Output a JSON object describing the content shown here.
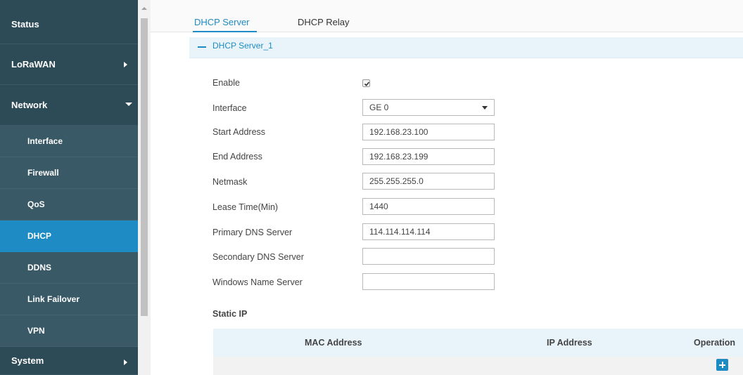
{
  "sidebar": {
    "items": [
      {
        "label": "Status"
      },
      {
        "label": "LoRaWAN"
      },
      {
        "label": "Network"
      },
      {
        "label": "Interface"
      },
      {
        "label": "Firewall"
      },
      {
        "label": "QoS"
      },
      {
        "label": "DHCP"
      },
      {
        "label": "DDNS"
      },
      {
        "label": "Link Failover"
      },
      {
        "label": "VPN"
      },
      {
        "label": "System"
      }
    ]
  },
  "tabs": [
    {
      "label": "DHCP Server"
    },
    {
      "label": "DHCP Relay"
    }
  ],
  "section": {
    "title": "DHCP Server_1"
  },
  "form": {
    "enable_label": "Enable",
    "enable_checked": true,
    "interface_label": "Interface",
    "interface_value": "GE 0",
    "start_label": "Start Address",
    "start_value": "192.168.23.100",
    "end_label": "End Address",
    "end_value": "192.168.23.199",
    "netmask_label": "Netmask",
    "netmask_value": "255.255.255.0",
    "lease_label": "Lease Time(Min)",
    "lease_value": "1440",
    "primary_dns_label": "Primary DNS Server",
    "primary_dns_value": "114.114.114.114",
    "secondary_dns_label": "Secondary DNS Server",
    "secondary_dns_value": "",
    "wins_label": "Windows Name Server",
    "wins_value": ""
  },
  "static_ip": {
    "title": "Static IP",
    "columns": [
      "MAC Address",
      "IP Address",
      "Operation"
    ]
  },
  "icons": {
    "add": "plus-icon",
    "collapse": "minus-icon",
    "expand": "caret-right-icon",
    "expanded": "caret-down-icon"
  },
  "colors": {
    "sidebar_bg": "#2d4a57",
    "active": "#1f8bc4",
    "section_bg": "#e9f4fa"
  }
}
